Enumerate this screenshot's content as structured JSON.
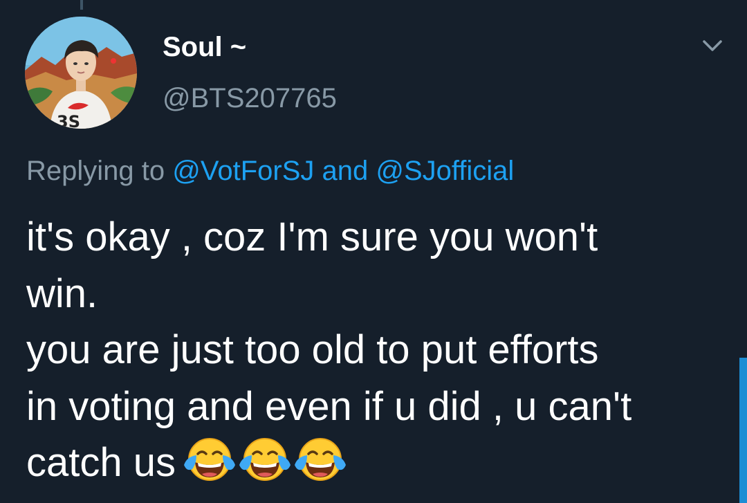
{
  "tweet": {
    "author": {
      "display_name": "Soul ~",
      "handle": "@BTS207765",
      "avatar": {
        "icon": "profile-photo",
        "shirt_text": "3S"
      }
    },
    "menu_icon": "chevron-down-icon",
    "reply_context": {
      "prefix": "Replying to",
      "mention_1": "@VotForSJ",
      "conjunction": "and",
      "mention_2": "@SJofficial"
    },
    "text_lines": [
      "it's okay , coz I'm sure you won't",
      "win.",
      "you are just too old to put efforts",
      "in voting and even if u did , u can't",
      "catch us"
    ],
    "emojis": [
      "face-with-tears-of-joy",
      "face-with-tears-of-joy",
      "face-with-tears-of-joy"
    ]
  },
  "colors": {
    "background": "#151f2b",
    "primary_text": "#ffffff",
    "secondary_text": "#8899a6",
    "accent": "#1da1f2"
  }
}
